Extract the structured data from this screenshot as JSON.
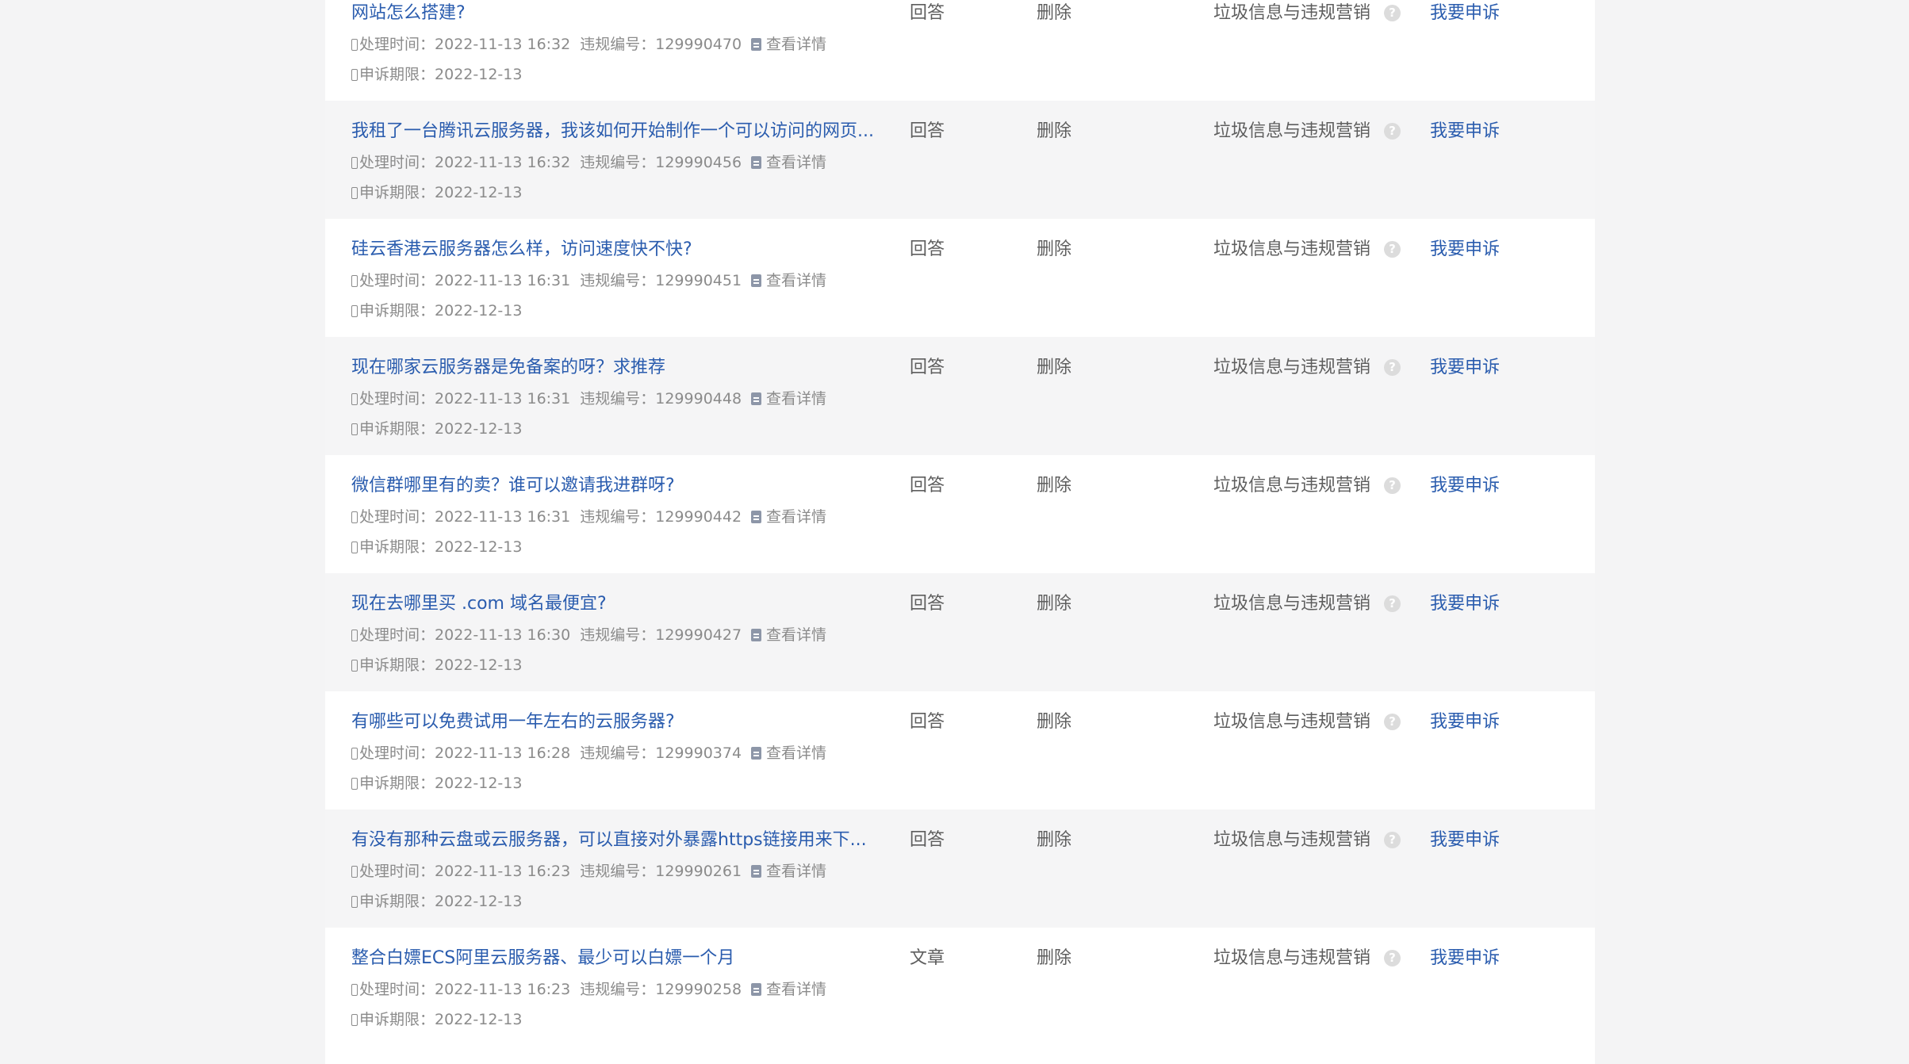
{
  "labels": {
    "process_time": "处理时间：",
    "violation_no": "违规编号：",
    "view_detail": "查看详情",
    "deadline": "申诉期限：",
    "appeal": "我要申诉",
    "help_icon": "?"
  },
  "rows": [
    {
      "title": "网站怎么搭建?",
      "time": "2022-11-13 16:32",
      "id": "129990470",
      "deadline": "2022-12-13",
      "type": "回答",
      "action": "删除",
      "reason": "垃圾信息与违规营销"
    },
    {
      "title": "我租了一台腾讯云服务器，我该如何开始制作一个可以访问的网页...",
      "time": "2022-11-13 16:32",
      "id": "129990456",
      "deadline": "2022-12-13",
      "type": "回答",
      "action": "删除",
      "reason": "垃圾信息与违规营销"
    },
    {
      "title": "硅云香港云服务器怎么样，访问速度快不快?",
      "time": "2022-11-13 16:31",
      "id": "129990451",
      "deadline": "2022-12-13",
      "type": "回答",
      "action": "删除",
      "reason": "垃圾信息与违规营销"
    },
    {
      "title": "现在哪家云服务器是免备案的呀？求推荐",
      "time": "2022-11-13 16:31",
      "id": "129990448",
      "deadline": "2022-12-13",
      "type": "回答",
      "action": "删除",
      "reason": "垃圾信息与违规营销"
    },
    {
      "title": "微信群哪里有的卖？谁可以邀请我进群呀?",
      "time": "2022-11-13 16:31",
      "id": "129990442",
      "deadline": "2022-12-13",
      "type": "回答",
      "action": "删除",
      "reason": "垃圾信息与违规营销"
    },
    {
      "title": "现在去哪里买 .com 域名最便宜?",
      "time": "2022-11-13 16:30",
      "id": "129990427",
      "deadline": "2022-12-13",
      "type": "回答",
      "action": "删除",
      "reason": "垃圾信息与违规营销"
    },
    {
      "title": "有哪些可以免费试用一年左右的云服务器?",
      "time": "2022-11-13 16:28",
      "id": "129990374",
      "deadline": "2022-12-13",
      "type": "回答",
      "action": "删除",
      "reason": "垃圾信息与违规营销"
    },
    {
      "title": "有没有那种云盘或云服务器，可以直接对外暴露https链接用来下...",
      "time": "2022-11-13 16:23",
      "id": "129990261",
      "deadline": "2022-12-13",
      "type": "回答",
      "action": "删除",
      "reason": "垃圾信息与违规营销"
    },
    {
      "title": "整合白嫖ECS阿里云服务器、最少可以白嫖一个月",
      "time": "2022-11-13 16:23",
      "id": "129990258",
      "deadline": "2022-12-13",
      "type": "文章",
      "action": "删除",
      "reason": "垃圾信息与违规营销"
    }
  ]
}
